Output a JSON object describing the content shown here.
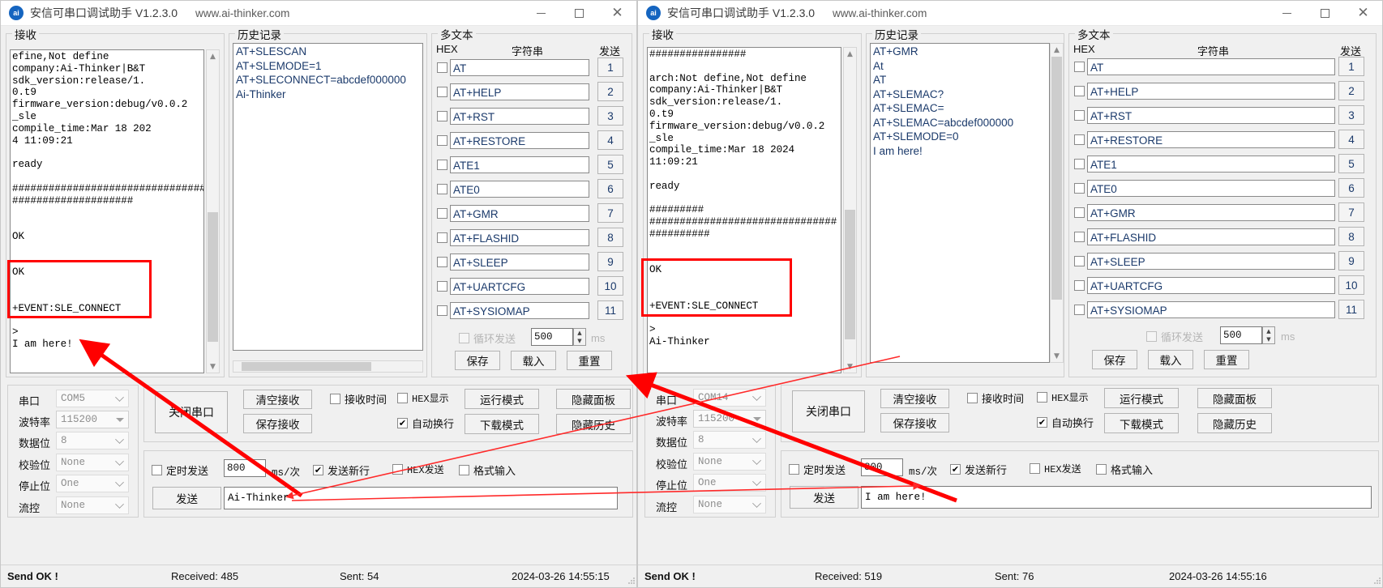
{
  "app": {
    "title": "安信可串口调试助手 V1.2.3.0",
    "url": "www.ai-thinker.com",
    "icon": "ai-thinker-logo-icon",
    "minimize": "–",
    "maximize": "□",
    "close": "✕"
  },
  "labels": {
    "receive_group": "接收",
    "history_group": "历史记录",
    "multitext_group": "多文本",
    "hex_col": "HEX",
    "string_col": "字符串",
    "send_col": "发送",
    "loop_send": "循环发送",
    "ms": "ms",
    "save": "保存",
    "load": "载入",
    "reset": "重置",
    "serial_port": "串口",
    "baud_rate": "波特率",
    "data_bits": "数据位",
    "parity": "校验位",
    "stop_bits": "停止位",
    "flow_control": "流控",
    "close_port": "关闭串口",
    "clear_receive": "清空接收",
    "save_receive": "保存接收",
    "receive_time": "接收时间",
    "hex_display": "HEX显示",
    "auto_wrap": "自动换行",
    "run_mode": "运行模式",
    "download_mode": "下载模式",
    "hide_panel": "隐藏面板",
    "hide_history": "隐藏历史",
    "timed_send": "定时发送",
    "ms_per_time": "ms/次",
    "send_newline": "发送新行",
    "hex_send": "HEX发送",
    "format_input": "格式输入",
    "send_button": "发送"
  },
  "multitext_rows": [
    {
      "n": "1",
      "value": "AT",
      "checked": false
    },
    {
      "n": "2",
      "value": "AT+HELP",
      "checked": false
    },
    {
      "n": "3",
      "value": "AT+RST",
      "checked": false
    },
    {
      "n": "4",
      "value": "AT+RESTORE",
      "checked": false
    },
    {
      "n": "5",
      "value": "ATE1",
      "checked": false
    },
    {
      "n": "6",
      "value": "ATE0",
      "checked": false
    },
    {
      "n": "7",
      "value": "AT+GMR",
      "checked": false
    },
    {
      "n": "8",
      "value": "AT+FLASHID",
      "checked": false
    },
    {
      "n": "9",
      "value": "AT+SLEEP",
      "checked": false
    },
    {
      "n": "10",
      "value": "AT+UARTCFG",
      "checked": false
    },
    {
      "n": "11",
      "value": "AT+SYSIOMAP",
      "checked": false
    }
  ],
  "left": {
    "receive_text": "efine,Not define\ncompany:Ai-Thinker|B&T\nsdk_version:release/1.\n0.t9\nfirmware_version:debug/v0.0.2\n_sle\ncompile_time:Mar 18 202\n4 11:09:21\n\nready\n\n################################\n####################\n\n\nOK\n\n\nOK\n\n\n+EVENT:SLE_CONNECT\n\n>\nI am here!",
    "history_text": "AT+SLESCAN\nAT+SLEMODE=1\nAT+SLECONNECT=abcdef000000\nAi-Thinker",
    "loop_interval": "500",
    "serial_port": "COM5",
    "baud_rate": "115200",
    "data_bits": "8",
    "parity": "None",
    "stop_bits": "One",
    "flow_control": "None",
    "timed_interval": "800",
    "send_text": "Ai-Thinker",
    "checks": {
      "loop_send": false,
      "receive_time": false,
      "hex_display": false,
      "auto_wrap": true,
      "timed_send": false,
      "send_newline": true,
      "hex_send": false,
      "format_input": false
    },
    "status": {
      "state": "Send OK !",
      "received": "Received: 485",
      "sent": "Sent: 54",
      "timestamp": "2024-03-26 14:55:15"
    }
  },
  "right": {
    "receive_text": "################\n\narch:Not define,Not define\ncompany:Ai-Thinker|B&T\nsdk_version:release/1.\n0.t9\nfirmware_version:debug/v0.0.2\n_sle\ncompile_time:Mar 18 2024\n11:09:21\n\nready\n\n#########\n###############################\n##########\n\n\nOK\n\n\n+EVENT:SLE_CONNECT\n\n>\nAi-Thinker",
    "history_text": "AT+GMR\nAt\nAT\nAT+SLEMAC?\nAT+SLEMAC=\nAT+SLEMAC=abcdef000000\nAT+SLEMODE=0\nI am here!",
    "loop_interval": "500",
    "serial_port": "COM14",
    "baud_rate": "115200",
    "data_bits": "8",
    "parity": "None",
    "stop_bits": "One",
    "flow_control": "None",
    "timed_interval": "800",
    "send_text": "I am here!",
    "checks": {
      "loop_send": false,
      "receive_time": false,
      "hex_display": false,
      "auto_wrap": true,
      "timed_send": false,
      "send_newline": true,
      "hex_send": false,
      "format_input": false
    },
    "status": {
      "state": "Send OK !",
      "received": "Received: 519",
      "sent": "Sent: 76",
      "timestamp": "2024-03-26 14:55:16"
    }
  },
  "annotations": {
    "highlight_color": "#ff0000",
    "arrow_color": "#ff0000"
  }
}
